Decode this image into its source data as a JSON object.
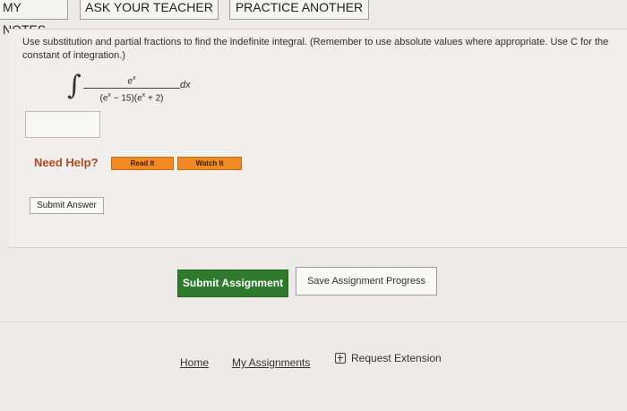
{
  "tabs": {
    "my_notes": "MY NOTES",
    "ask_your_teacher": "ASK YOUR TEACHER",
    "practice_another": "PRACTICE ANOTHER"
  },
  "question": {
    "instructions": "Use substitution and partial fractions to find the indefinite integral. (Remember to use absolute values where appropriate. Use C for the constant of integration.)",
    "integral": {
      "numerator": "e",
      "numerator_exp": "x",
      "denominator_part1": "(e",
      "denominator_exp1": "x",
      "denominator_part2": " − 15)(e",
      "denominator_exp2": "x",
      "denominator_part3": " + 2)",
      "differential": "dx"
    },
    "answer_value": ""
  },
  "help": {
    "label": "Need Help?",
    "read_it": "Read It",
    "watch_it": "Watch It"
  },
  "submit_answer": "Submit Answer",
  "assignment": {
    "submit": "Submit Assignment",
    "save_progress": "Save Assignment Progress"
  },
  "footer": {
    "home": "Home",
    "my_assignments": "My Assignments",
    "request_extension": "Request Extension"
  },
  "colors": {
    "help_orange": "#f08a23",
    "submit_green": "#2f7a2c",
    "need_help_text": "#b34a1e"
  }
}
